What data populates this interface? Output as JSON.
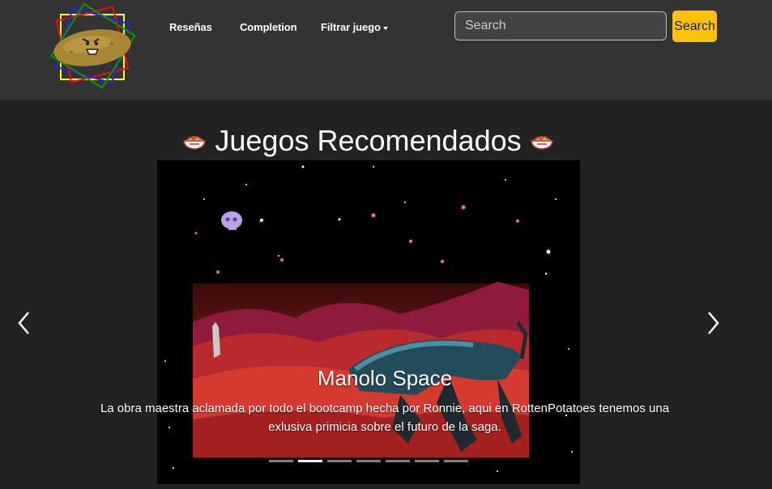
{
  "nav": {
    "links": [
      "Reseñas",
      "Completion",
      "Filtrar juego"
    ],
    "search_placeholder": "Search",
    "search_button": "Search"
  },
  "section": {
    "title": "Juegos Recomendados",
    "emoji_icon": "noodle-bowl-icon"
  },
  "carousel": {
    "slide_title": "Manolo Space",
    "slide_text": "La obra maestra aclamada por todo el bootcamp hecha por Ronnie, aqui en RottenPotatoes tenemos una exlusiva primicia sobre el futuro de la saga.",
    "indicator_count": 7,
    "active_index": 1,
    "prev_icon": "chevron-left-icon",
    "next_icon": "chevron-right-icon"
  },
  "colors": {
    "navbar_bg": "#333333",
    "page_bg": "#222222",
    "accent": "#ffc107"
  }
}
